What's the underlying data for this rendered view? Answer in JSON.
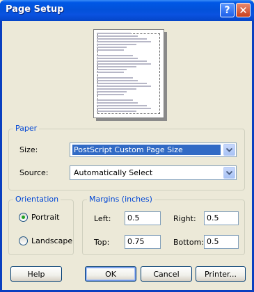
{
  "window": {
    "title": "Page Setup",
    "help_button": "?",
    "close_button": "✕"
  },
  "paper": {
    "group_label": "Paper",
    "size_label": "Size:",
    "size_value": "PostScript Custom Page Size",
    "source_label": "Source:",
    "source_value": "Automatically Select"
  },
  "orientation": {
    "group_label": "Orientation",
    "portrait_label": "Portrait",
    "landscape_label": "Landscape",
    "selected": "Portrait"
  },
  "margins": {
    "group_label": "Margins (inches)",
    "left_label": "Left:",
    "left_value": "0.5",
    "right_label": "Right:",
    "right_value": "0.5",
    "top_label": "Top:",
    "top_value": "0.75",
    "bottom_label": "Bottom:",
    "bottom_value": "0.5"
  },
  "buttons": {
    "help": "Help",
    "ok": "OK",
    "cancel": "Cancel",
    "printer": "Printer..."
  },
  "colors": {
    "dialog_bg": "#ECE9D8",
    "titlebar": "#0251D9",
    "group_label": "#0046D5",
    "selection": "#316AC5",
    "radio_dot": "#21A121"
  }
}
